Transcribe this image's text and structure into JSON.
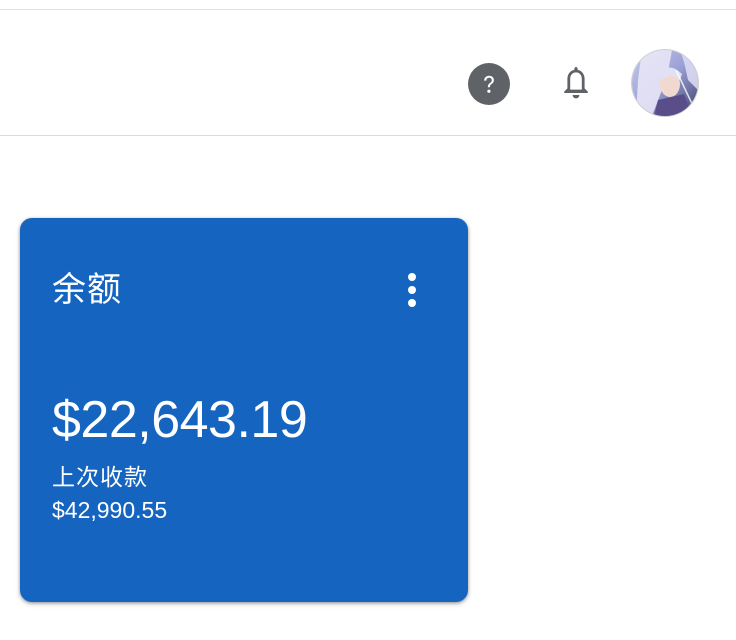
{
  "header": {
    "help_icon": "help-circle-icon",
    "notifications_icon": "bell-icon",
    "avatar_icon": "user-avatar"
  },
  "card": {
    "title": "余额",
    "menu_icon": "more-vert-icon",
    "balance": "$22,643.19",
    "last_payment_label": "上次收款",
    "last_payment_amount": "$42,990.55",
    "color": "#1565c0"
  }
}
